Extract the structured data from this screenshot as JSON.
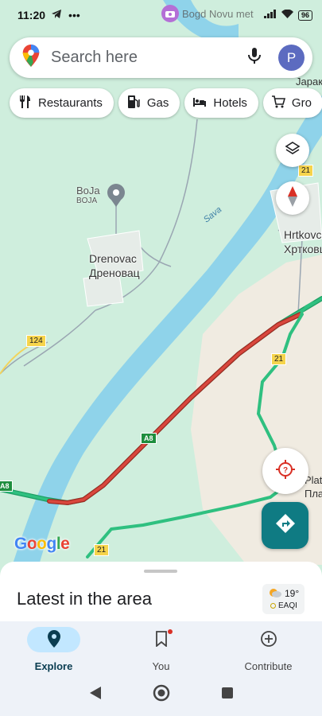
{
  "status_bar": {
    "time": "11:20",
    "notification": "Bogd Novu met",
    "battery": "96"
  },
  "search": {
    "placeholder": "Search here",
    "avatar_letter": "P"
  },
  "chips": [
    {
      "label": "Restaurants",
      "icon": "fork-knife-icon"
    },
    {
      "label": "Gas",
      "icon": "gas-pump-icon"
    },
    {
      "label": "Hotels",
      "icon": "bed-icon"
    },
    {
      "label": "Gro",
      "icon": "cart-icon"
    }
  ],
  "map": {
    "places": {
      "boja_latin": "BoJa",
      "boja_cyrillic": "BOJA",
      "drenovac_latin": "Drenovac",
      "drenovac_cyrillic": "Дреновац",
      "hrtkovci_latin": "Hrtkovc",
      "hrtkovci_cyrillic": "Хртковц",
      "jarak_latin": "ak",
      "jarak_cyrillic": "Јарак",
      "platicevo_latin": "Plat",
      "platicevo_cyrillic": "Плат"
    },
    "river_label": "Sava",
    "road_badges": {
      "r124": "124",
      "r21a": "21",
      "r21b": "21",
      "r21c": "21",
      "a8a": "A8",
      "a8b": "A8"
    },
    "colors": {
      "land": "#cfeedd",
      "water": "#8fd3ea",
      "field": "#f0ebe1",
      "traffic_slow": "#d9473d",
      "traffic_free": "#2fc080",
      "accent": "#0f7b83"
    }
  },
  "google_logo": {
    "letters": [
      "G",
      "o",
      "o",
      "g",
      "l",
      "e"
    ],
    "colors": [
      "#4285f4",
      "#ea4335",
      "#fbbc05",
      "#4285f4",
      "#34a853",
      "#ea4335"
    ]
  },
  "sheet": {
    "title": "Latest in the area",
    "weather": {
      "temp": "19°",
      "aqi_label": "EAQI"
    }
  },
  "bottom_nav": {
    "items": [
      {
        "label": "Explore",
        "icon": "explore-pin-icon",
        "active": true
      },
      {
        "label": "You",
        "icon": "bookmark-icon",
        "active": false
      },
      {
        "label": "Contribute",
        "icon": "add-circle-icon",
        "active": false
      }
    ]
  }
}
